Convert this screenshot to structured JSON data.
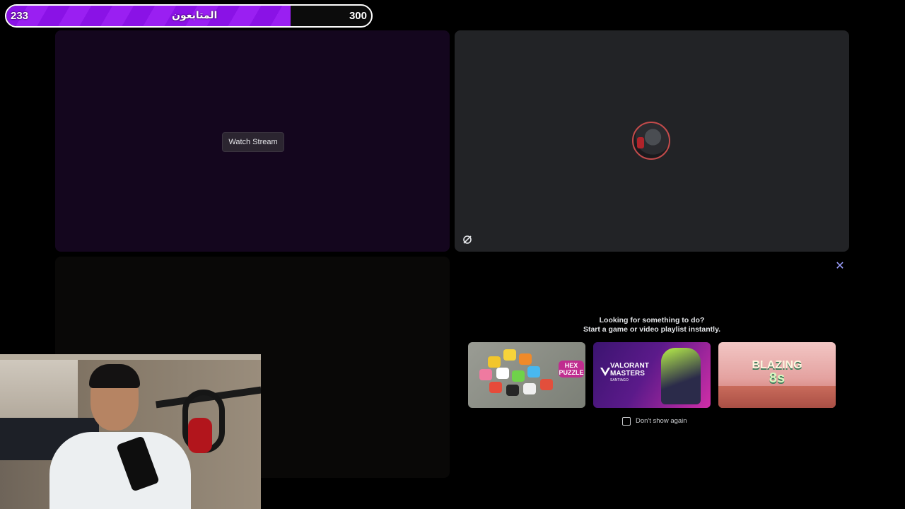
{
  "goal": {
    "current": "233",
    "label": "المتابعون",
    "target": "300",
    "progress_fraction": 0.78
  },
  "stream_tile": {
    "watch_button_label": "Watch Stream"
  },
  "activity_panel": {
    "headline_line1": "Looking for something to do?",
    "headline_line2": "Start a game or video playlist instantly.",
    "cards": [
      {
        "name": "Hex Puzzle",
        "title_line1": "HEX",
        "title_line2": "PUZZLE"
      },
      {
        "name": "Valorant Masters",
        "title_line1": "VALORANT",
        "title_line2": "MASTERS",
        "subtitle": "SANTIAGO"
      },
      {
        "name": "Blazing 8s",
        "title_line1": "BLAZING",
        "title_line2": "8s"
      }
    ],
    "dont_show_again_label": "Don't show again",
    "close_icon": "close-icon"
  },
  "colors": {
    "goal_fill": "#8a12e6",
    "stream_tile_bg": "#14061e",
    "user_tile_bg": "#222326",
    "close_accent": "#9da0ff"
  }
}
